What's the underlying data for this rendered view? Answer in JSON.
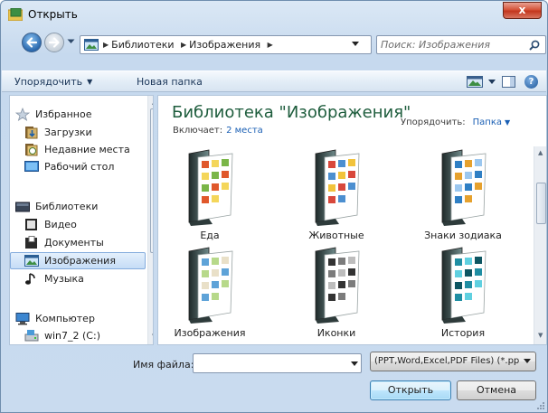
{
  "window": {
    "title": "Открыть",
    "close_label": "x"
  },
  "address": {
    "breadcrumbs": [
      "Библиотеки",
      "Изображения"
    ],
    "search_placeholder": "Поиск: Изображения"
  },
  "toolbar": {
    "organize_label": "Упорядочить",
    "new_folder_label": "Новая папка",
    "help_label": "?"
  },
  "nav": {
    "favorites": {
      "label": "Избранное",
      "items": [
        "Загрузки",
        "Недавние места",
        "Рабочий стол"
      ]
    },
    "libraries": {
      "label": "Библиотеки",
      "items": [
        "Видео",
        "Документы",
        "Изображения",
        "Музыка"
      ],
      "selected": "Изображения"
    },
    "computer": {
      "label": "Компьютер",
      "items": [
        "win7_2 (C:)"
      ]
    }
  },
  "content": {
    "title": "Библиотека \"Изображения\"",
    "includes_label": "Включает:",
    "includes_link": "2 места",
    "arrange_label": "Упорядочить:",
    "arrange_value": "Папка",
    "folders": [
      "Еда",
      "Животные",
      "Знаки зодиака",
      "Изображения",
      "Иконки",
      "История"
    ]
  },
  "bottom": {
    "filename_label": "Имя файла:",
    "filename_value": "",
    "filetype_value": "(PPT,Word,Excel,PDF Files) (*.pp",
    "open_label": "Открыть",
    "cancel_label": "Отмена"
  },
  "colors": {
    "accent": "#1e5d3d",
    "link": "#1a5fb4",
    "selection": "#c5dcf6",
    "close": "#c3361d"
  }
}
